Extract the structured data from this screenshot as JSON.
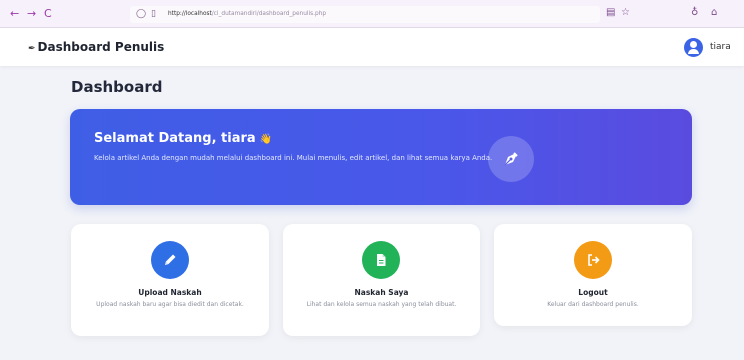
{
  "browser": {
    "back_glyph": "←",
    "forward_glyph": "→",
    "reload_glyph": "C",
    "url_host": "http://localhost",
    "url_path": "/ci_dutamandiri/dashboard_penulis.php",
    "icons": [
      "back-arrow-icon",
      "forward-arrow-icon",
      "reload-icon",
      "shield-icon",
      "page-icon",
      "reader-view-icon",
      "bookmark-star-icon",
      "firefox-account-icon",
      "extensions-icon"
    ]
  },
  "header": {
    "brand": "Dashboard Penulis",
    "user_name": "tiara"
  },
  "main": {
    "title": "Dashboard",
    "hero": {
      "title": "Selamat Datang, tiara",
      "emoji": "👋",
      "text": "Kelola artikel Anda dengan mudah melalui dashboard ini. Mulai menulis, edit artikel, dan lihat semua karya Anda."
    },
    "cards": [
      {
        "title": "Upload Naskah",
        "desc": "Upload naskah baru agar bisa diedit dan dicetak.",
        "color": "#2f6fe6",
        "icon": "pencil-icon"
      },
      {
        "title": "Naskah Saya",
        "desc": "Lihat dan kelola semua naskah yang telah dibuat.",
        "color": "#22b257",
        "icon": "file-icon"
      },
      {
        "title": "Logout",
        "desc": "Keluar dari dashboard penulis.",
        "color": "#f39b14",
        "icon": "logout-icon"
      }
    ]
  },
  "colors": {
    "hero_start": "#3f5ee6",
    "hero_end": "#5a4bdf",
    "avatar": "#3b63e6",
    "page_bg": "#f1f3f8"
  }
}
